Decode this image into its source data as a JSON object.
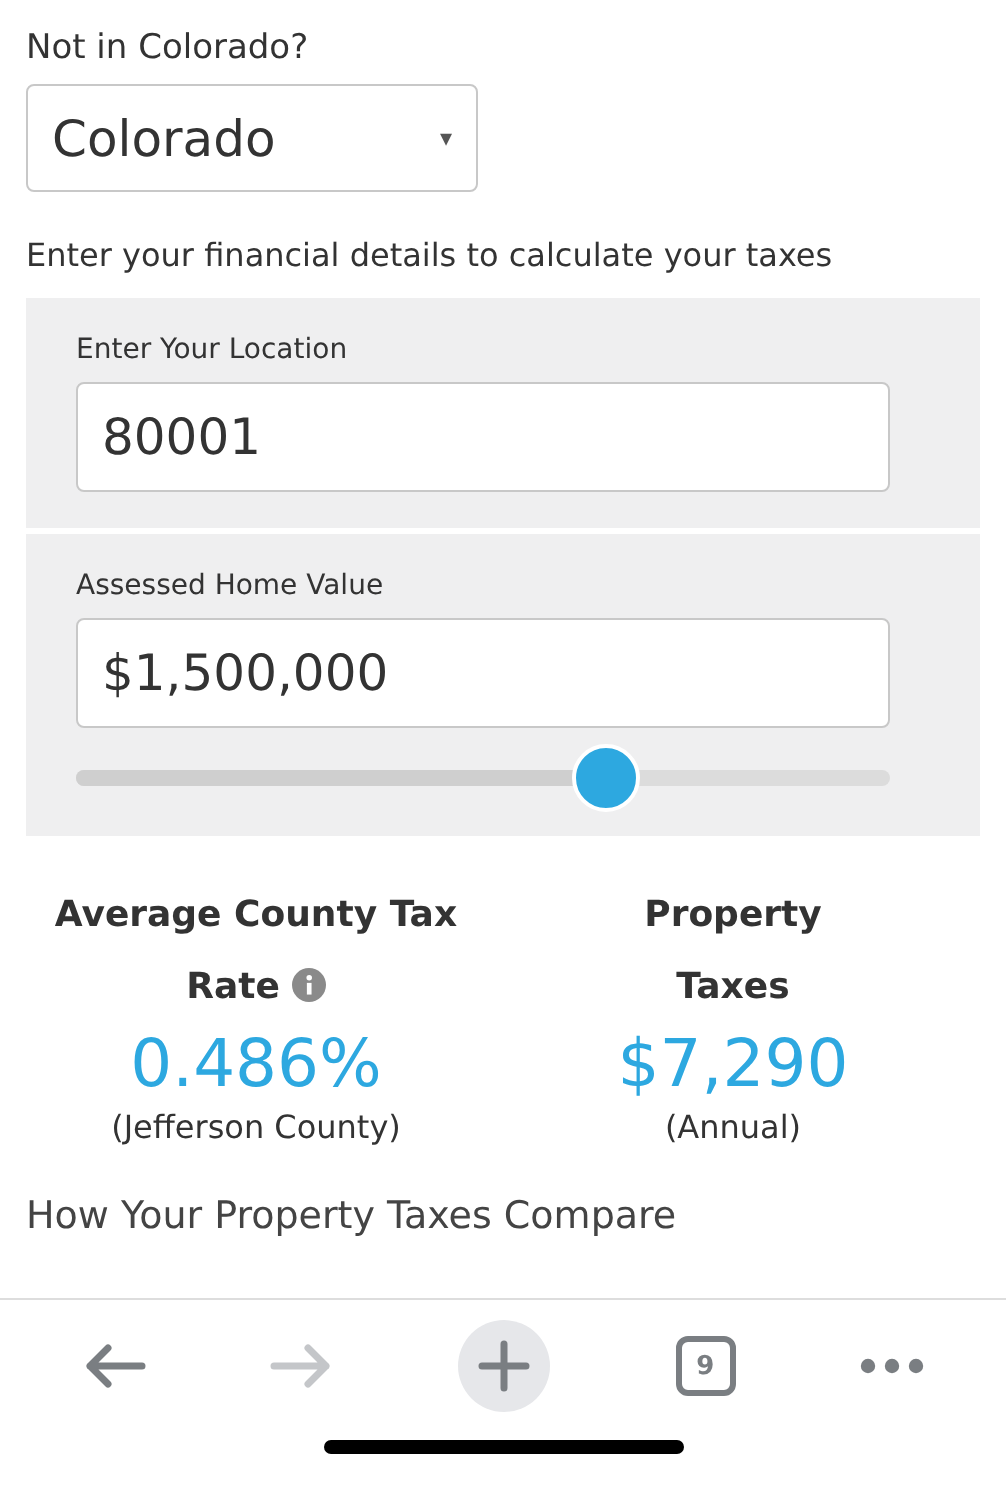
{
  "state_prompt": "Not in Colorado?",
  "state_select": {
    "value": "Colorado",
    "caret": "▾"
  },
  "intro": "Enter your financial details to calculate your taxes",
  "location": {
    "label": "Enter Your Location",
    "value": "80001"
  },
  "home_value": {
    "label": "Assessed Home Value",
    "value": "$1,500,000",
    "slider": {
      "level": 0.65
    }
  },
  "results": [
    {
      "title": "Average County Tax Rate",
      "info": true,
      "value": "0.486%",
      "note": "(Jefferson County)"
    },
    {
      "title": "Property Taxes",
      "info": false,
      "value": "$7,290",
      "note": "(Annual)"
    }
  ],
  "next_heading": "How Your Property Taxes Compare",
  "toolbar": {
    "items": [
      {
        "kind": "back",
        "disabled": false
      },
      {
        "kind": "forward",
        "disabled": true
      },
      {
        "kind": "new-tab",
        "disabled": false
      },
      {
        "kind": "tabs",
        "count": "9",
        "disabled": false
      },
      {
        "kind": "more",
        "disabled": false
      }
    ]
  }
}
